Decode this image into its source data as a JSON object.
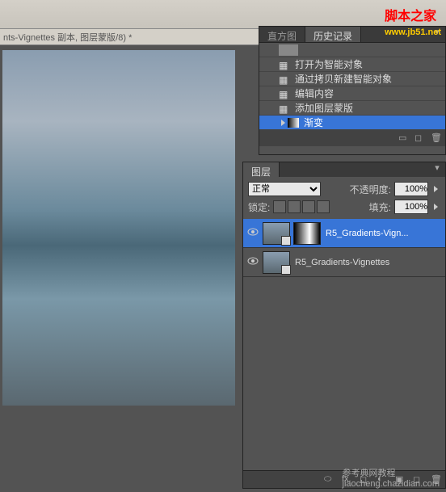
{
  "tab_strip": {
    "document_title": "nts-Vignettes 副本, 图层蒙版/8) *"
  },
  "history_panel": {
    "tabs": {
      "histogram": "直方图",
      "history": "历史记录"
    },
    "items": [
      {
        "label": "",
        "is_thumb": true
      },
      {
        "label": "打开为智能对象"
      },
      {
        "label": "通过拷贝新建智能对象"
      },
      {
        "label": "编辑内容"
      },
      {
        "label": "添加图层蒙版"
      },
      {
        "label": "渐变",
        "selected": true
      }
    ]
  },
  "layers_panel": {
    "tab": "图层",
    "blend_mode": "正常",
    "opacity_label": "不透明度:",
    "opacity_value": "100%",
    "lock_label": "锁定:",
    "fill_label": "填充:",
    "fill_value": "100%",
    "layers": [
      {
        "name": "R5_Gradients-Vign...",
        "selected": true,
        "has_mask": true
      },
      {
        "name": "R5_Gradients-Vignettes",
        "selected": false,
        "has_mask": false
      }
    ]
  },
  "footer_icons": {
    "link": "链接",
    "fx": "fx.",
    "mask": "蒙版",
    "adjust": "调整",
    "group": "组",
    "new": "新建",
    "trash": "删除"
  },
  "watermark": {
    "top_prefix": "脚本",
    "top_suffix": "之家",
    "url": "www.jb51.net",
    "bottom": "参考典网教程",
    "bottom2": "jiaocheng.chazidian.com"
  }
}
